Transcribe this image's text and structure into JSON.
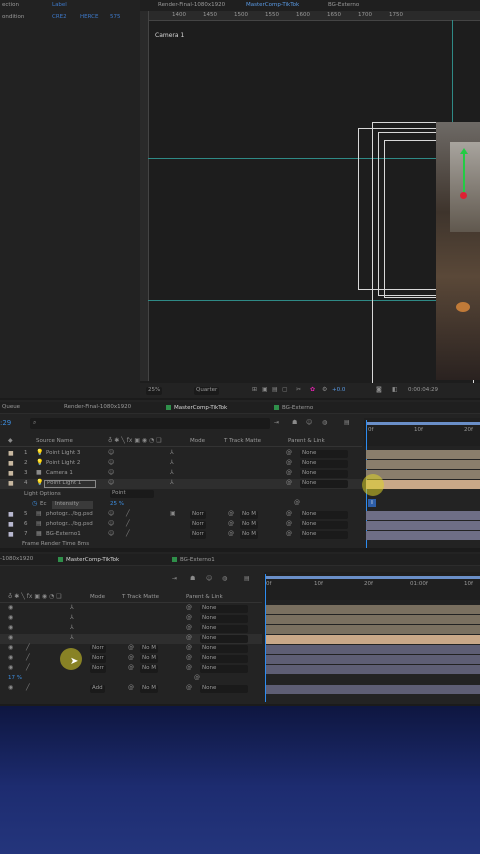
{
  "project_panel": {
    "label_1": "ection",
    "label_1_val": "Label",
    "label_2": "ondition",
    "label_2_vals": [
      "CRE2",
      "HERCE",
      "575"
    ]
  },
  "viewer": {
    "tabs": [
      "Render-Final-1080x1920",
      "MasterComp-TikTok",
      "BG-Externo"
    ],
    "camera_label": "Camera 1",
    "ruler_ticks": [
      "1400",
      "1450",
      "1500",
      "1550",
      "1600",
      "1650",
      "1700",
      "1750"
    ],
    "zoom": "25%",
    "resolution": "Quarter",
    "exposure": "+0.0",
    "timecode": "0:00:04:29"
  },
  "timeline1": {
    "tabs": [
      "Queue",
      "Render-Final-1080x1920",
      "MasterComp-TikTok",
      "BG-Externo"
    ],
    "timecode": ":29",
    "headers": {
      "source": "Source Name",
      "mode": "Mode",
      "track_matte": "T  Track Matte",
      "parent": "Parent & Link"
    },
    "ruler": [
      "0f",
      "10f",
      "20f"
    ],
    "layers": [
      {
        "num": "1",
        "name": "Point Light 3",
        "parent": "None"
      },
      {
        "num": "2",
        "name": "Point Light 2",
        "parent": "None"
      },
      {
        "num": "3",
        "name": "Camera 1",
        "parent": "None"
      },
      {
        "num": "4",
        "name": "Point Light 1",
        "parent": "None"
      },
      {
        "num": "5",
        "name": "photogr.../bg.psd",
        "mode": "Norr",
        "matte": "No M",
        "parent": "None"
      },
      {
        "num": "6",
        "name": "photogr.../bg.psd",
        "mode": "Norr",
        "matte": "No M",
        "parent": "None"
      },
      {
        "num": "7",
        "name": "BG-Externo1",
        "mode": "Norr",
        "matte": "No M",
        "parent": "None"
      }
    ],
    "light_options": "Light Options",
    "light_options_value": "Point",
    "intensity_label": "Intensity",
    "intensity_value": "25 %",
    "footer": "Frame Render Time  8ms"
  },
  "timeline2": {
    "tabs": [
      "-1080x1920",
      "MasterComp-TikTok",
      "BG-Externo1"
    ],
    "headers": {
      "mode": "Mode",
      "track_matte": "T  Track Matte",
      "parent": "Parent & Link"
    },
    "ruler": [
      "0f",
      "10f",
      "20f",
      "01:00f",
      "10f"
    ],
    "rows": [
      {
        "parent": "None"
      },
      {
        "parent": "None"
      },
      {
        "parent": "None"
      },
      {
        "parent": "None"
      },
      {
        "mode": "Norr",
        "matte": "No M",
        "parent": "None"
      },
      {
        "mode": "Norr",
        "matte": "No M",
        "parent": "None"
      },
      {
        "mode": "Norr",
        "matte": "No M",
        "parent": "None"
      },
      {
        "mode": "Add",
        "matte": "No M",
        "parent": "None"
      }
    ],
    "pct": "17 %"
  },
  "colors": {
    "accent": "#2d8cf0",
    "tab_green": "#2f8f4a",
    "highlight_bar": "#c9a888",
    "background_blue": "#1c2a6b"
  }
}
